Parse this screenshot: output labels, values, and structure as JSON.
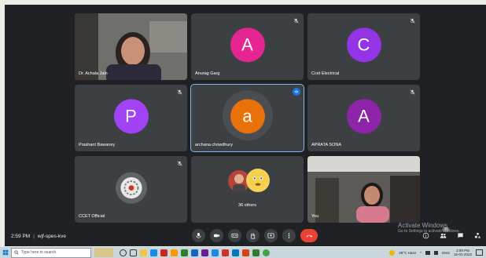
{
  "participants": [
    {
      "name": "Dr. Achala Jain",
      "type": "video"
    },
    {
      "name": "Anurag Garg",
      "initial": "A",
      "color": "#e52592"
    },
    {
      "name": "Ccet Electrical",
      "initial": "C",
      "color": "#9334e6"
    },
    {
      "name": "Prashant Bawaney",
      "initial": "P",
      "color": "#a142f4"
    },
    {
      "name": "archana chowdhury",
      "initial": "a",
      "color": "#e8710a",
      "active": true
    },
    {
      "name": "APRATA SONA",
      "initial": "A",
      "color": "#8e24aa"
    },
    {
      "name": "CCET Official",
      "type": "logo"
    },
    {
      "name": "36 others",
      "type": "group"
    },
    {
      "name": "You",
      "type": "video"
    }
  ],
  "meeting": {
    "time": "2:59 PM",
    "code": "wjf-spes-kve"
  },
  "watermark": {
    "line1": "Activate Windows",
    "line2": "Go to Settings to activate Windows."
  },
  "side_badge": "36",
  "taskbar": {
    "search_placeholder": "Type here to search",
    "weather": "29°C Haze",
    "lang": "ENG",
    "time": "2:59 PM",
    "date": "15-01-2022"
  },
  "colors": {
    "accent": "#8ab4f8",
    "end_call": "#ea4335",
    "bg": "#202124",
    "tile": "#3c4043"
  }
}
